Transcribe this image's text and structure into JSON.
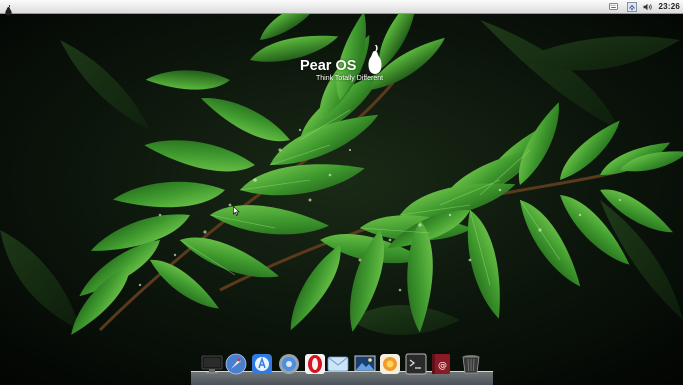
{
  "menubar": {
    "menu_icon": "pear-icon",
    "tray": {
      "keyboard_icon": "keyboard-icon",
      "network_icon": "network-icon",
      "volume_icon": "volume-icon",
      "clock": "23:26"
    }
  },
  "desktop": {
    "wallpaper": "green fern leaves with water drops",
    "brand": {
      "name": "Pear OS",
      "tagline": "Think Totally Different",
      "logo_icon": "pear-logo-icon"
    }
  },
  "dock": {
    "items": [
      {
        "icon": "monitor-icon"
      },
      {
        "icon": "launchpad-rocket-icon"
      },
      {
        "icon": "app-store-icon"
      },
      {
        "icon": "system-settings-icon"
      },
      {
        "icon": "opera-browser-icon"
      },
      {
        "icon": "mail-icon"
      },
      {
        "icon": "image-viewer-icon"
      },
      {
        "icon": "photos-flower-icon"
      },
      {
        "icon": "terminal-icon"
      },
      {
        "icon": "contacts-icon"
      },
      {
        "icon": "trash-icon"
      }
    ]
  },
  "colors": {
    "menubar": "#e6e6e6",
    "leaf_green": "#3f9a2e",
    "background": "#050805"
  }
}
